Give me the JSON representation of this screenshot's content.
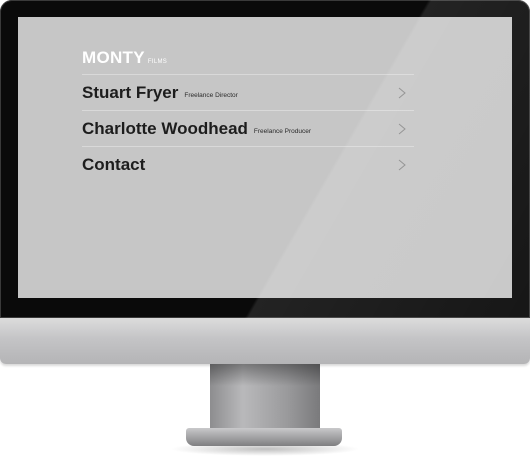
{
  "site": {
    "brand": "MONTY",
    "brand_suffix": "FILMS"
  },
  "menu": {
    "items": [
      {
        "name": "Stuart Fryer",
        "role": "Freelance Director",
        "icon": "chevron-right-icon"
      },
      {
        "name": "Charlotte Woodhead",
        "role": "Freelance Producer",
        "icon": "chevron-right-icon"
      },
      {
        "name": "Contact",
        "role": "",
        "icon": "chevron-right-icon"
      }
    ]
  },
  "colors": {
    "screen_background": "#c6c6c6",
    "brand_text": "#ffffff",
    "menu_text": "#1d1d1d",
    "divider": "#d9d9d9"
  }
}
